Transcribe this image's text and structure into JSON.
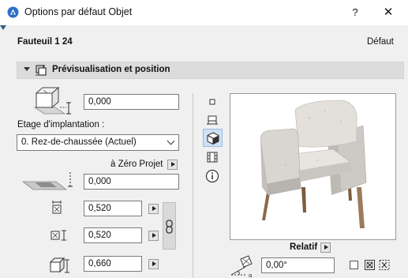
{
  "window": {
    "title": "Options par défaut Objet",
    "help_label": "?",
    "close_label": "✕"
  },
  "header": {
    "object_name": "Fauteuil 1 24",
    "default_label": "Défaut"
  },
  "section": {
    "title": "Prévisualisation et position"
  },
  "position": {
    "elevation_value": "0,000",
    "story_label": "Etage d'implantation :",
    "story_value": "0. Rez-de-chaussée (Actuel)",
    "zero_label": "à Zéro Projet",
    "zero_value": "0,000",
    "width_value": "0,520",
    "depth_value": "0,520",
    "height_value": "0,660"
  },
  "preview": {
    "relative_label": "Relatif",
    "angle_value": "0,00°"
  },
  "colors": {
    "title_bg": "#ffffff",
    "panel_bg": "#f0f0f0",
    "section_bg": "#dcdcdc",
    "accent": "#3a74c8",
    "chair_fabric": "#d8d4cf",
    "chair_wood": "#9a7a5a"
  },
  "icons": [
    "app-icon",
    "help-icon",
    "close-icon",
    "preview-position-icon",
    "elevation-box-icon",
    "zero-plane-icon",
    "width-icon",
    "depth-icon",
    "height-icon",
    "chain-link-icon",
    "view-2d-icon",
    "view-section-icon",
    "view-3d-icon",
    "view-list-icon",
    "info-icon",
    "angle-icon"
  ]
}
